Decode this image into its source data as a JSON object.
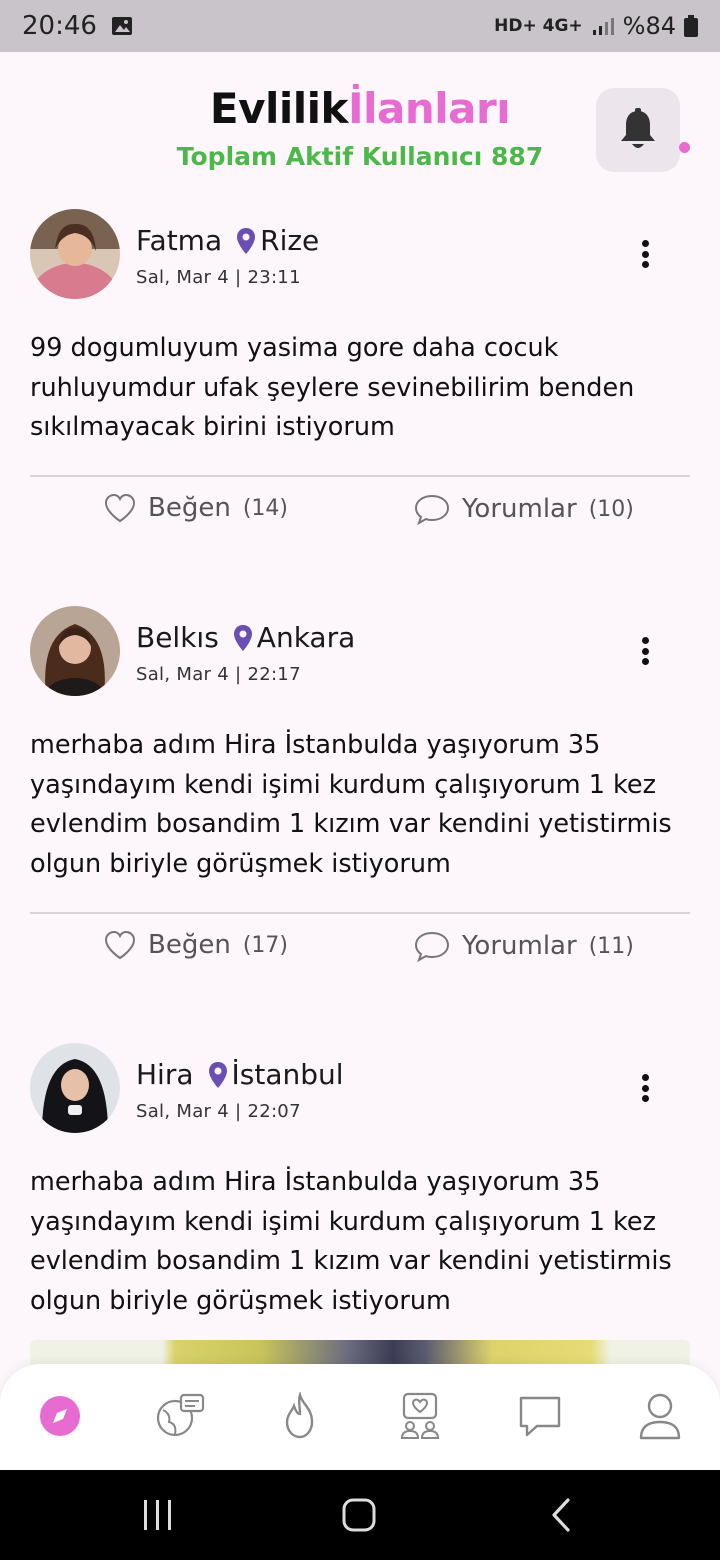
{
  "status_bar": {
    "time": "20:46",
    "network": "HD+ 4G+",
    "battery": "%84"
  },
  "header": {
    "brand_part1": "Evlilik",
    "brand_part2": "İlanları",
    "subtitle": "Toplam Aktif Kullanıcı 887",
    "accent_color": "#e86bd2",
    "subtitle_color": "#4cb84a"
  },
  "posts": [
    {
      "name": "Fatma",
      "city": "Rize",
      "date": "Sal, Mar 4 | 23:11",
      "text": "99 dogumluyum yasima gore daha cocuk ruhluyumdur ufak şeylere sevinebilirim benden sıkılmayacak birini istiyorum",
      "like_label": "Beğen",
      "like_count": "(14)",
      "comment_label": "Yorumlar",
      "comment_count": "(10)"
    },
    {
      "name": "Belkıs",
      "city": "Ankara",
      "date": "Sal, Mar 4 | 22:17",
      "text": "merhaba adım Hira İstanbulda yaşıyorum 35 yaşındayım kendi işimi kurdum çalışıyorum 1 kez evlendim bosandim 1 kızım var kendini yetistirmis olgun biriyle görüşmek istiyorum",
      "like_label": "Beğen",
      "like_count": "(17)",
      "comment_label": "Yorumlar",
      "comment_count": "(11)"
    },
    {
      "name": "Hira",
      "city": "İstanbul",
      "date": "Sal, Mar 4 | 22:07",
      "text": "merhaba adım Hira İstanbulda yaşıyorum 35 yaşındayım kendi işimi kurdum çalışıyorum 1 kez evlendim bosandim 1 kızım var kendini yetistirmis olgun biriyle görüşmek istiyorum"
    }
  ],
  "bottom_nav": {
    "items": [
      "compass-icon",
      "globe-chat-icon",
      "flame-icon",
      "matches-icon",
      "chat-icon",
      "profile-icon"
    ],
    "active": "compass-icon",
    "active_color": "#e86bd2"
  },
  "pin_color": "#6b4fb3"
}
